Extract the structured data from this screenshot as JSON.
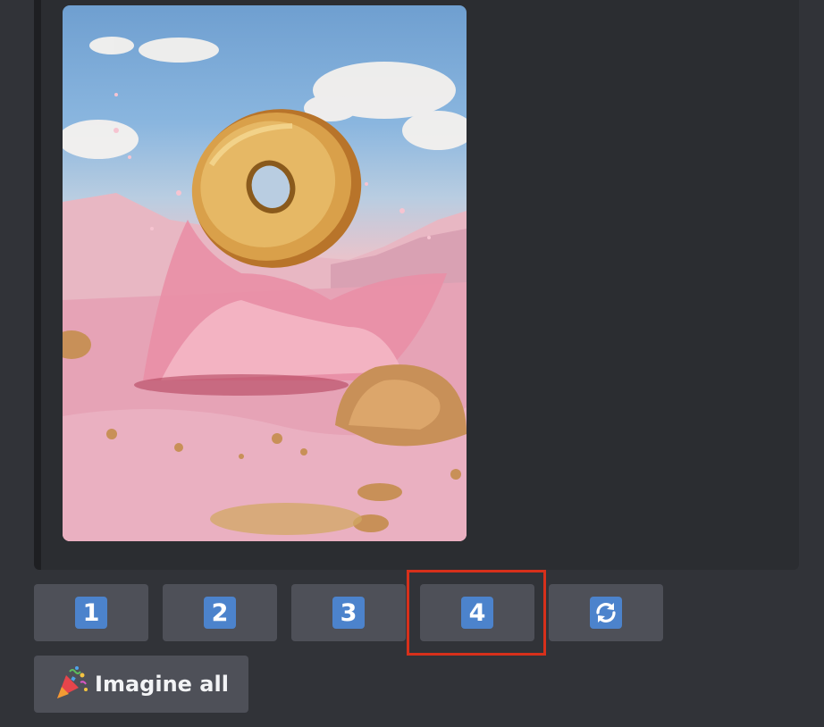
{
  "upscale_buttons": [
    {
      "label": "1"
    },
    {
      "label": "2"
    },
    {
      "label": "3"
    },
    {
      "label": "4"
    }
  ],
  "reroll_button": {
    "icon": "refresh-icon"
  },
  "imagine_all_button": {
    "label": "Imagine all",
    "icon": "party-popper-icon"
  },
  "colors": {
    "background": "#313338",
    "embed_background": "#2b2d31",
    "button_background": "#4e5058",
    "keycap_blue": "#4c83cc",
    "highlight_red": "#d7301b"
  }
}
